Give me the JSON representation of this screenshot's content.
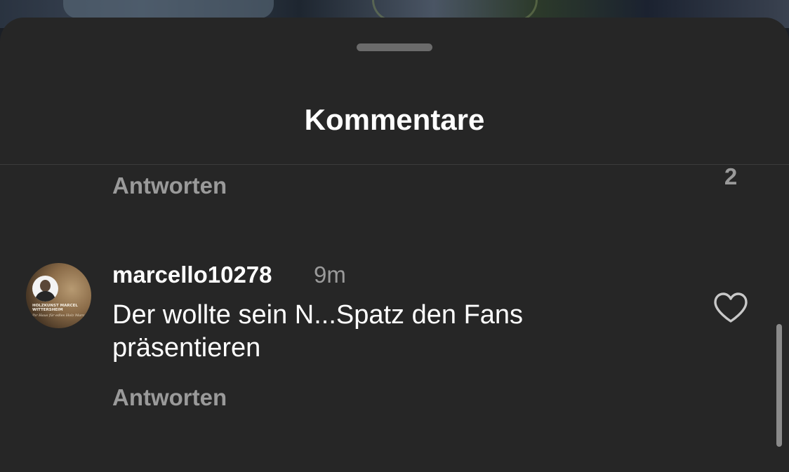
{
  "sheet": {
    "title": "Kommentare"
  },
  "previous_comment": {
    "reply_label": "Antworten",
    "like_count": "2"
  },
  "comment": {
    "username": "marcello10278",
    "time": "9m",
    "text_line1": "Der wollte sein N...Spatz den Fans",
    "text_line2": "präsentieren",
    "reply_label": "Antworten",
    "avatar": {
      "brand_line1": "HOLZKUNST MARCEL",
      "brand_line2": "WITTERSHEIM",
      "brand_line3": "Ihr Haus für edles Holz Marcel"
    },
    "like_icon": "heart-outline-icon"
  },
  "colors": {
    "sheet_background": "#262626",
    "text_primary": "#ffffff",
    "text_secondary": "#9a9a9a"
  }
}
